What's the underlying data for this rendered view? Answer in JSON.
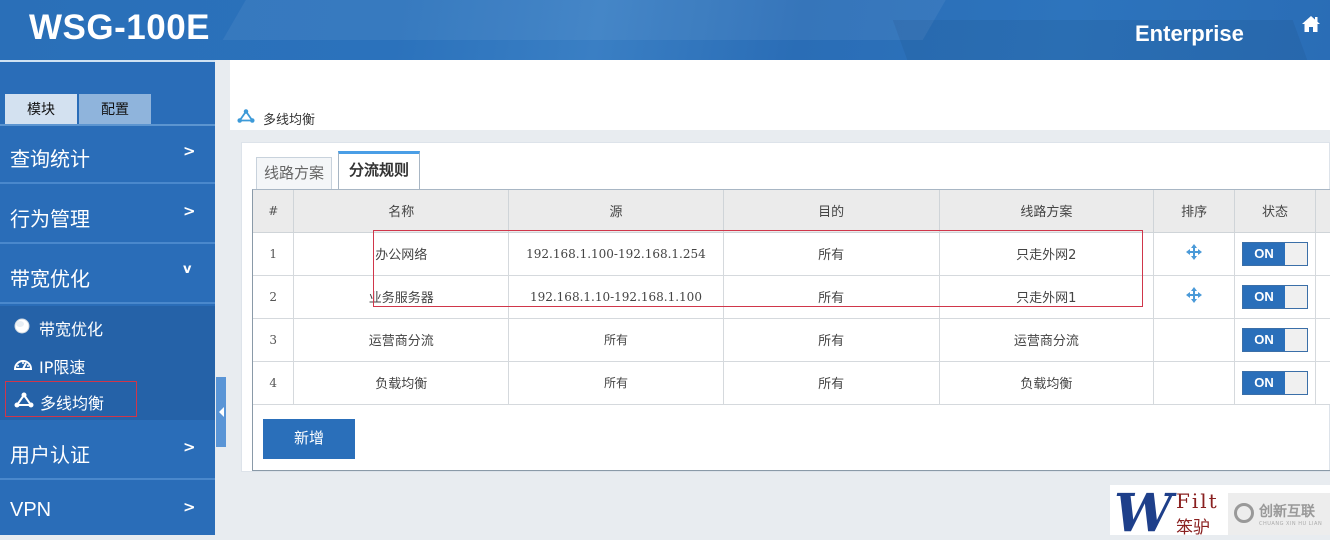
{
  "header": {
    "product": "WSG-100E",
    "edition": "Enterprise",
    "home_icon": "home-icon"
  },
  "sidebar": {
    "mode_tabs": [
      {
        "label": "模块",
        "active": true
      },
      {
        "label": "配置",
        "active": false
      }
    ],
    "items": [
      {
        "label": "查询统计",
        "chevron": ">"
      },
      {
        "label": "行为管理",
        "chevron": ">"
      },
      {
        "label": "带宽优化",
        "chevron": "v",
        "expanded": true
      },
      {
        "label": "用户认证",
        "chevron": ">"
      },
      {
        "label": "VPN",
        "chevron": ">"
      }
    ],
    "subitems": [
      {
        "label": "带宽优化",
        "icon": "globe-icon"
      },
      {
        "label": "IP限速",
        "icon": "speedometer-icon"
      },
      {
        "label": "多线均衡",
        "icon": "network-triangle-icon",
        "active": true
      }
    ]
  },
  "main": {
    "page_title": "多线均衡",
    "tabs": [
      {
        "label": "线路方案",
        "active": false
      },
      {
        "label": "分流规则",
        "active": true
      }
    ],
    "table": {
      "headers": [
        "#",
        "名称",
        "源",
        "目的",
        "线路方案",
        "排序",
        "状态"
      ],
      "rows": [
        {
          "index": "1",
          "name": "办公网络",
          "source": "192.168.1.100-192.168.1.254",
          "destination": "所有",
          "line_plan": "只走外网2",
          "sortable": true,
          "status": "ON"
        },
        {
          "index": "2",
          "name": "业务服务器",
          "source": "192.168.1.10-192.168.1.100",
          "destination": "所有",
          "line_plan": "只走外网1",
          "sortable": true,
          "status": "ON"
        },
        {
          "index": "3",
          "name": "运营商分流",
          "source": "所有",
          "destination": "所有",
          "line_plan": "运营商分流",
          "sortable": false,
          "status": "ON"
        },
        {
          "index": "4",
          "name": "负载均衡",
          "source": "所有",
          "destination": "所有",
          "line_plan": "负载均衡",
          "sortable": false,
          "status": "ON"
        }
      ]
    },
    "add_button": "新增"
  },
  "watermark": {
    "logo_letter": "W",
    "text_en": "Filt",
    "text_cn": "笨驴",
    "overlay_cn": "创新互联",
    "overlay_en": "CHUANG XIN HU LIAN"
  },
  "colors": {
    "brand_blue": "#2a6fba",
    "highlight_red": "#d0364a",
    "tab_accent": "#4a9ee6"
  }
}
